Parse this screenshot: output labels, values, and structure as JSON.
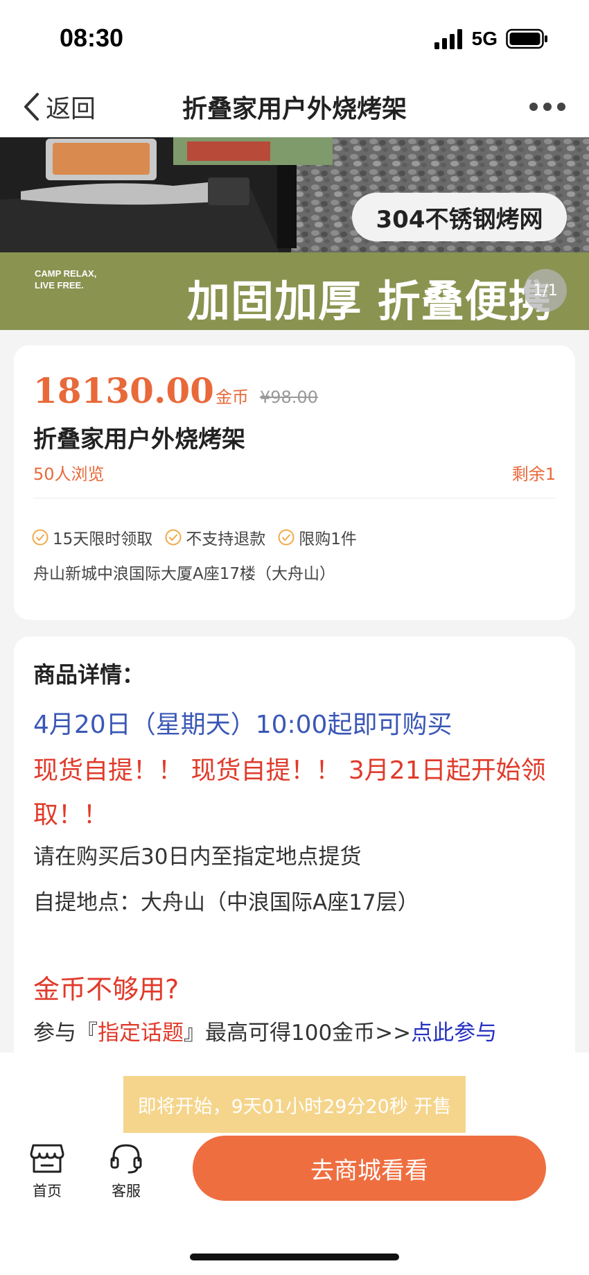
{
  "status_bar": {
    "time": "08:30",
    "network": "5G",
    "icons": [
      "signal-icon",
      "battery-icon"
    ]
  },
  "nav": {
    "back_label": "返回",
    "title": "折叠家用户外烧烤架",
    "icons": [
      "chevron-left-icon",
      "more-icon"
    ]
  },
  "banner": {
    "badge_text": "304不锈钢烤网",
    "camp_line1": "CAMP RELAX,",
    "camp_line2": "LIVE FREE.",
    "slogan": "加固加厚 折叠便携",
    "page_counter": "1/1"
  },
  "product": {
    "price": "18130.00",
    "price_unit": "金币",
    "original_price": "¥98.00",
    "name": "折叠家用户外烧烤架",
    "views": "50人浏览",
    "stock": "剩余1",
    "tags": [
      "15天限时领取",
      "不支持退款",
      "限购1件"
    ],
    "address": "舟山新城中浪国际大厦A座17楼（大舟山）"
  },
  "details": {
    "heading": "商品详情：",
    "line_blue": "4月20日（星期天）10:00起即可购买",
    "line_red": "现货自提！！ 现货自提！！ 3月21日起开始领取！！",
    "line_grey_1": "请在购买后30日内至指定地点提货",
    "line_grey_2": "自提地点：大舟山（中浪国际A座17层）",
    "coins_heading": "金币不够用?",
    "topic_prefix": "参与『",
    "topic_name": "指定话题",
    "topic_suffix": "』最高可得100金币>>",
    "join_link": "点此参与"
  },
  "bottom": {
    "countdown": "即将开始，9天01小时29分20秒 开售",
    "home_label": "首页",
    "service_label": "客服",
    "shop_button": "去商城看看"
  },
  "colors": {
    "accent": "#ef6e40",
    "price": "#e8693a",
    "blue_text": "#3a57b6",
    "red_text": "#e03a2a",
    "countdown_bg": "#f5d58c"
  }
}
